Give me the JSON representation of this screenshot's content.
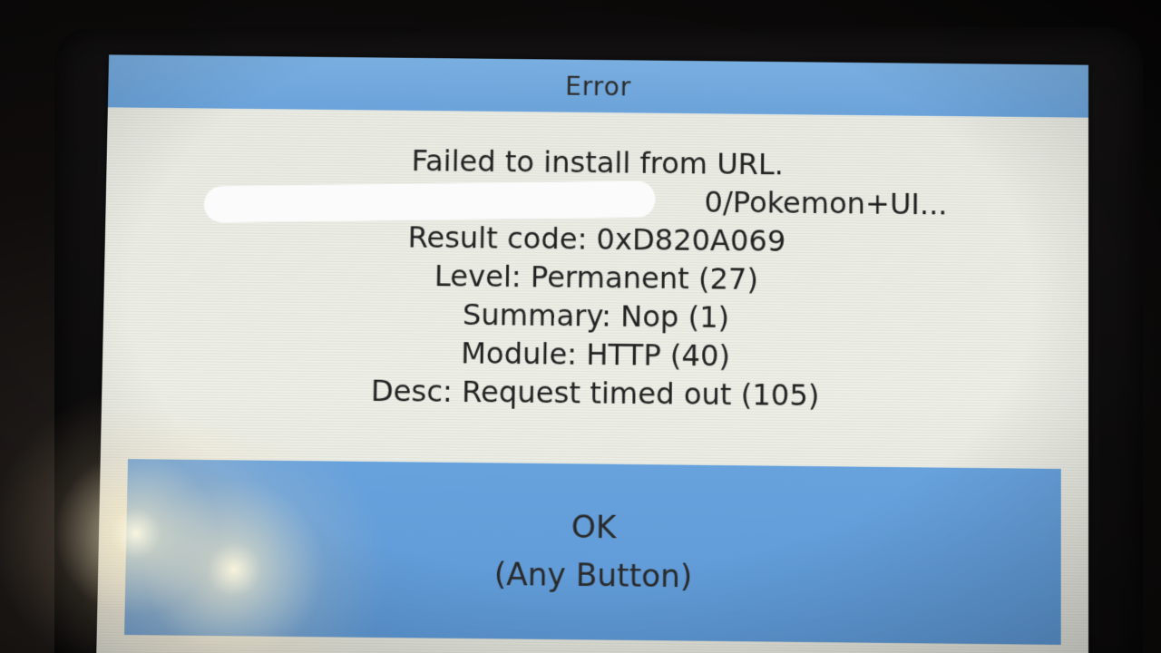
{
  "dialog": {
    "title": "Error",
    "message": {
      "headline": "Failed to install from URL.",
      "url_fragment": "0/Pokemon+UI...",
      "result_code": "Result code: 0xD820A069",
      "level": "Level: Permanent (27)",
      "summary": "Summary: Nop (1)",
      "module": "Module: HTTP (40)",
      "desc": "Desc: Request timed out (105)"
    },
    "ok_button": {
      "label": "OK",
      "sublabel": "(Any Button)"
    }
  },
  "colors": {
    "titlebar": "#6ba3da",
    "button": "#5e99d6",
    "background": "#eef0e8",
    "text": "#222222"
  }
}
